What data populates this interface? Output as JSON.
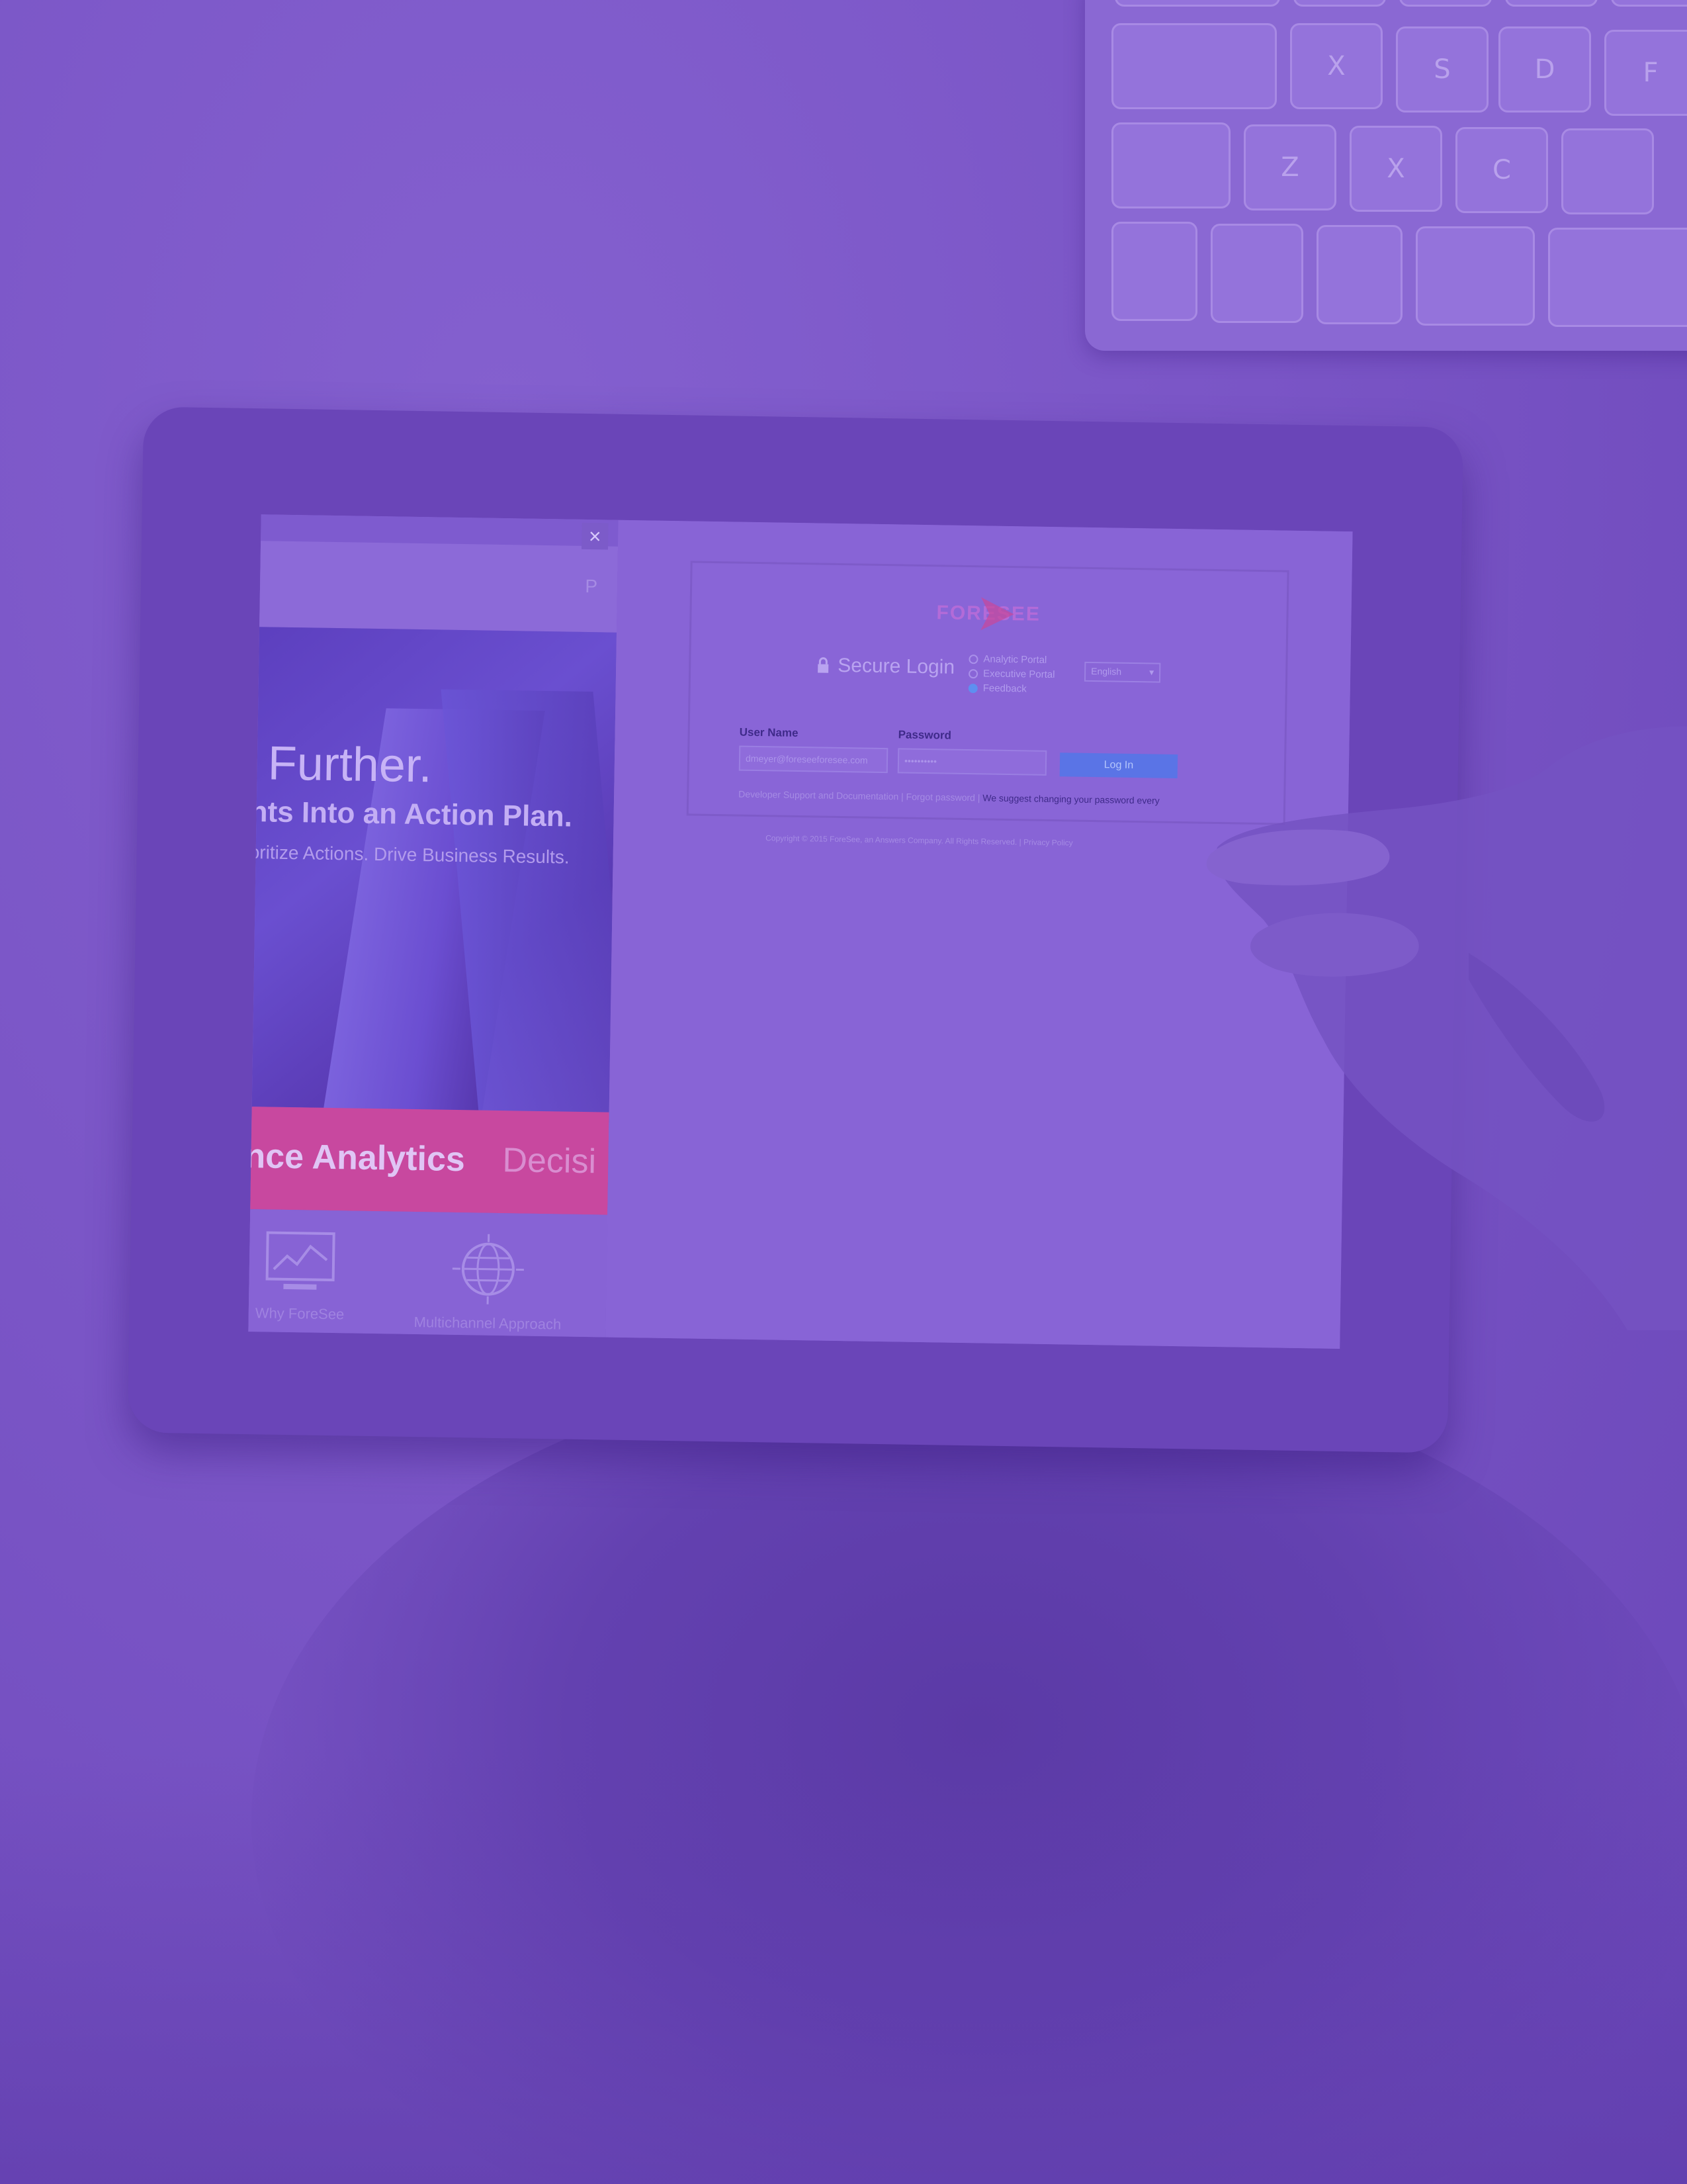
{
  "colors": {
    "overlay": "#7b56c7",
    "tablet_frame": "#6a45b8",
    "brand_logo": "#b36bd8",
    "login_button": "#5a74e6",
    "band": "#c8489f"
  },
  "keyboard": {
    "keys": [
      "",
      "X",
      "S",
      "D",
      "F",
      "",
      "Z",
      "X",
      "C",
      "",
      "",
      "",
      "",
      ""
    ]
  },
  "site": {
    "close_glyph": "×",
    "topbar_link": "P",
    "hero_heading": "k Further.",
    "hero_subheading": "hts Into an Action Plan.",
    "hero_tagline": "oritize Actions. Drive Business Results.",
    "band_bold": "nce Analytics",
    "band_light": "Decisi",
    "features": [
      {
        "label": "Why ForeSee",
        "icon": "monitor-chart-icon"
      },
      {
        "label": "Multichannel Approach",
        "icon": "globe-icon"
      }
    ]
  },
  "login": {
    "logo": "FORESEE",
    "title": "Secure Login",
    "portal_options": [
      {
        "label": "Analytic Portal",
        "selected": false
      },
      {
        "label": "Executive Portal",
        "selected": false
      },
      {
        "label": "Feedback",
        "selected": true
      }
    ],
    "language": "English",
    "username_label": "User Name",
    "username_value": "dmeyer@foreseeforesee.com",
    "password_label": "Password",
    "password_value": "••••••••••",
    "login_button": "Log In",
    "links_text": "Developer Support and Documentation | Forgot password |",
    "warning_text": "We suggest changing your password every",
    "copyright": "Copyright © 2015 ForeSee, an Answers Company. All Rights Reserved. | Privacy Policy"
  }
}
